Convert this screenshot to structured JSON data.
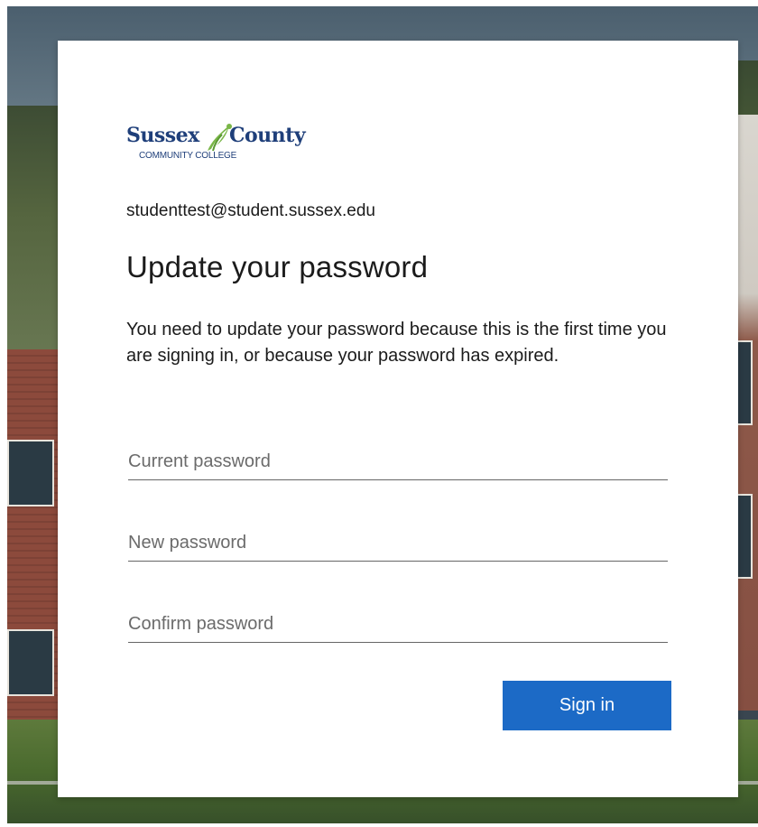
{
  "logo": {
    "word_left": "Sussex",
    "word_right": "County",
    "subtitle": "COMMUNITY COLLEGE",
    "brand_blue": "#1f3f7a",
    "leaf_green": "#7ab648"
  },
  "account": {
    "email": "studenttest@student.sussex.edu"
  },
  "form": {
    "title": "Update your password",
    "description": "You need to update your password because this is the first time you are signing in, or because your password has expired.",
    "current_password": {
      "placeholder": "Current password",
      "value": ""
    },
    "new_password": {
      "placeholder": "New password",
      "value": ""
    },
    "confirm_password": {
      "placeholder": "Confirm password",
      "value": ""
    },
    "submit_label": "Sign in",
    "button_color": "#1c6ac6"
  }
}
